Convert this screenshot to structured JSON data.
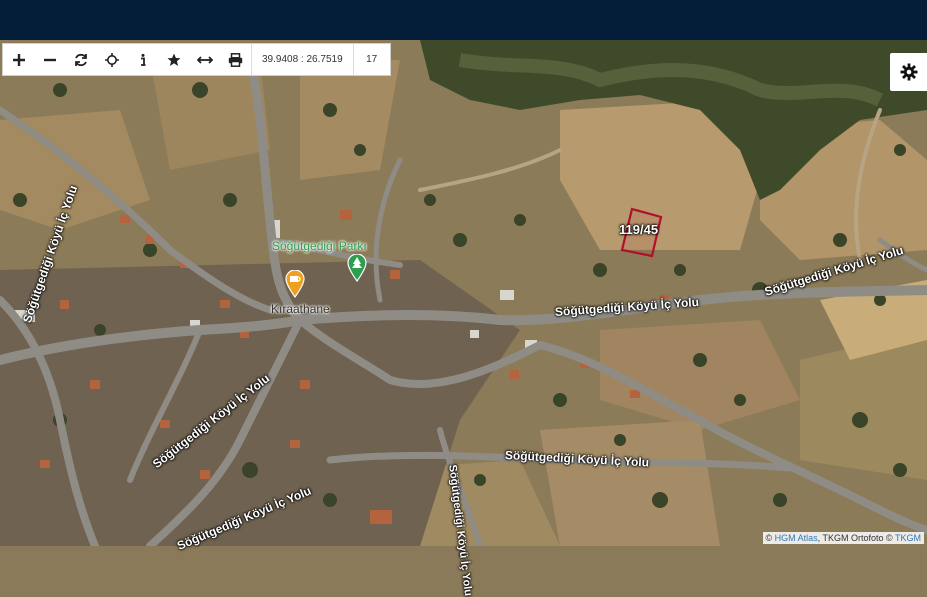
{
  "toolbar": {
    "buttons": [
      {
        "name": "zoom-in-button",
        "icon": "plus-icon"
      },
      {
        "name": "zoom-out-button",
        "icon": "minus-icon"
      },
      {
        "name": "refresh-button",
        "icon": "refresh-icon"
      },
      {
        "name": "locate-button",
        "icon": "crosshair-icon"
      },
      {
        "name": "info-button",
        "icon": "info-icon"
      },
      {
        "name": "favorite-button",
        "icon": "star-icon"
      },
      {
        "name": "measure-button",
        "icon": "measure-icon"
      },
      {
        "name": "print-button",
        "icon": "printer-icon"
      }
    ],
    "coordinates": "39.9408 : 26.7519",
    "zoom_level": "17"
  },
  "map": {
    "parcel_label": "119/45",
    "places": {
      "park": "Söğütgediği Parkı",
      "cafe": "Kıraathane"
    },
    "roads": {
      "r1": "Söğütgediği Köyü İç Yolu",
      "r2": "Söğütgediği Köyü İç Yolu",
      "r3": "Söğütgediği Köyü İç Yolu",
      "r4": "Söğütgediği Köyü İç Yolu",
      "r5": "Söğütgediği Köyü İç Yolu",
      "r6": "Söğütgediği Köyü İç Yolu",
      "r7": "Söğütgediği Köyü İç Yolu",
      "r8": "Söğütgediği Köyü İç Yolu",
      "r9": "Söğütgediği Köyü İç Yolu"
    },
    "park_color": "#2e9e4f",
    "cafe_color": "#f0a020",
    "parcel_color": "#b0102a"
  },
  "attribution": {
    "prefix": "©",
    "hgm": "HGM Atlas",
    "mid": ", TKGM Ortofoto ©",
    "tkgm": "TKGM"
  }
}
